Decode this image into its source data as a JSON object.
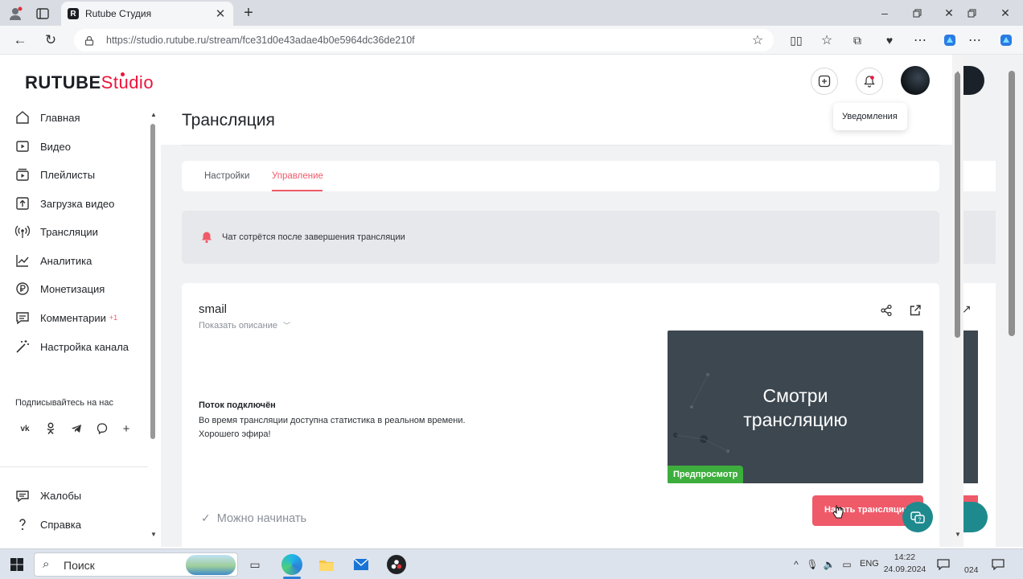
{
  "browser": {
    "tab_title": "Rutube Студия",
    "tab_icon": "R",
    "url": "https://studio.rutube.ru/stream/fce31d0e43adae4b0e5964dc36de210f"
  },
  "logo": {
    "part1": "RUTUBE",
    "part2": "Studio"
  },
  "sidebar": {
    "items": [
      {
        "label": "Главная",
        "icon": "home-icon"
      },
      {
        "label": "Видео",
        "icon": "video-icon"
      },
      {
        "label": "Плейлисты",
        "icon": "playlist-icon"
      },
      {
        "label": "Загрузка видео",
        "icon": "upload-icon"
      },
      {
        "label": "Трансляции",
        "icon": "broadcast-icon"
      },
      {
        "label": "Аналитика",
        "icon": "analytics-icon"
      },
      {
        "label": "Монетизация",
        "icon": "money-icon"
      },
      {
        "label": "Комментарии",
        "icon": "comments-icon",
        "badge": "+1"
      },
      {
        "label": "Настройка канала",
        "icon": "wand-icon"
      }
    ],
    "subscribe_title": "Подписывайтесь на нас",
    "socials": [
      "vk",
      "ok",
      "telegram",
      "viber",
      "+"
    ],
    "bottom": [
      {
        "label": "Жалобы",
        "icon": "flag-icon"
      },
      {
        "label": "Справка",
        "icon": "help-icon"
      }
    ]
  },
  "header": {
    "tooltip": "Уведомления"
  },
  "main": {
    "title": "Трансляция",
    "tabs": [
      {
        "label": "Настройки",
        "active": false
      },
      {
        "label": "Управление",
        "active": true
      }
    ],
    "notice": "Чат сотрётся после завершения трансляции",
    "stream": {
      "name": "smail",
      "show_description": "Показать описание",
      "status_title": "Поток подключён",
      "status_line1": "Во время трансляции доступна статистика в реальном времени.",
      "status_line2": "Хорошего эфира!",
      "ready_label": "Можно начинать",
      "preview_text_line1": "Смотри",
      "preview_text_line2": "трансляцию",
      "preview_badge": "Предпросмотр",
      "start_button": "Начать трансляцию"
    }
  },
  "taskbar": {
    "search": "Поиск",
    "lang": "ENG",
    "time": "14:22",
    "date": "24.09.2024"
  },
  "colors": {
    "accent": "#ed143b",
    "tab_active": "#f05a6a",
    "preview_badge": "#3dae3d",
    "start_button": "#ef5a69"
  }
}
